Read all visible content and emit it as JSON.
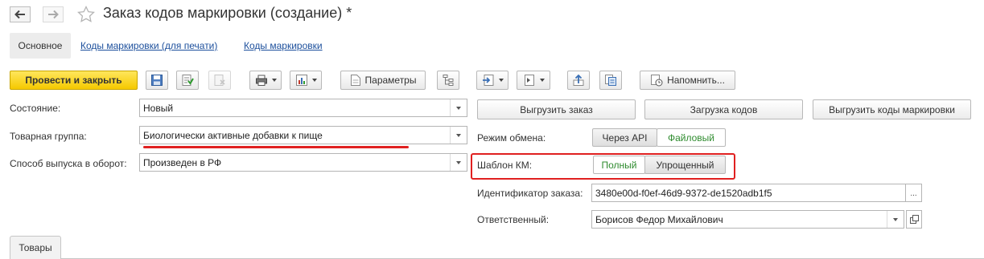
{
  "window": {
    "title": "Заказ кодов маркировки (создание) *"
  },
  "form_tabs": [
    {
      "label": "Основное"
    },
    {
      "label": "Коды маркировки (для печати)"
    },
    {
      "label": "Коды маркировки"
    }
  ],
  "toolbar": {
    "post_and_close_label": "Провести и закрыть",
    "parameters_label": "Параметры",
    "remind_label": "Напомнить..."
  },
  "fields": {
    "state": {
      "label": "Состояние:",
      "value": "Новый"
    },
    "product_group": {
      "label": "Товарная группа:",
      "value": "Биологически активные добавки к пище"
    },
    "release_method": {
      "label": "Способ выпуска в оборот:",
      "value": "Произведен в РФ"
    },
    "order_id": {
      "label": "Идентификатор заказа:",
      "value": "3480e00d-f0ef-46d9-9372-de1520adb1f5",
      "select_label": "..."
    },
    "responsible": {
      "label": "Ответственный:",
      "value": "Борисов Федор Михайлович"
    }
  },
  "actions": {
    "export_order_label": "Выгрузить заказ",
    "load_codes_label": "Загрузка кодов",
    "export_codes_label": "Выгрузить коды маркировки"
  },
  "exchange_mode": {
    "label": "Режим обмена:",
    "options": [
      "Через API",
      "Файловый"
    ],
    "selected": "Файловый"
  },
  "km_template": {
    "label": "Шаблон КМ:",
    "options": [
      "Полный",
      "Упрощенный"
    ],
    "selected": "Полный"
  },
  "bottom_tabs": [
    {
      "label": "Товары"
    }
  ],
  "colors": {
    "accent_primary": "#f5c900",
    "link": "#1c4f9c",
    "selected_option": "#2e8b2e",
    "highlight": "#e02020"
  }
}
